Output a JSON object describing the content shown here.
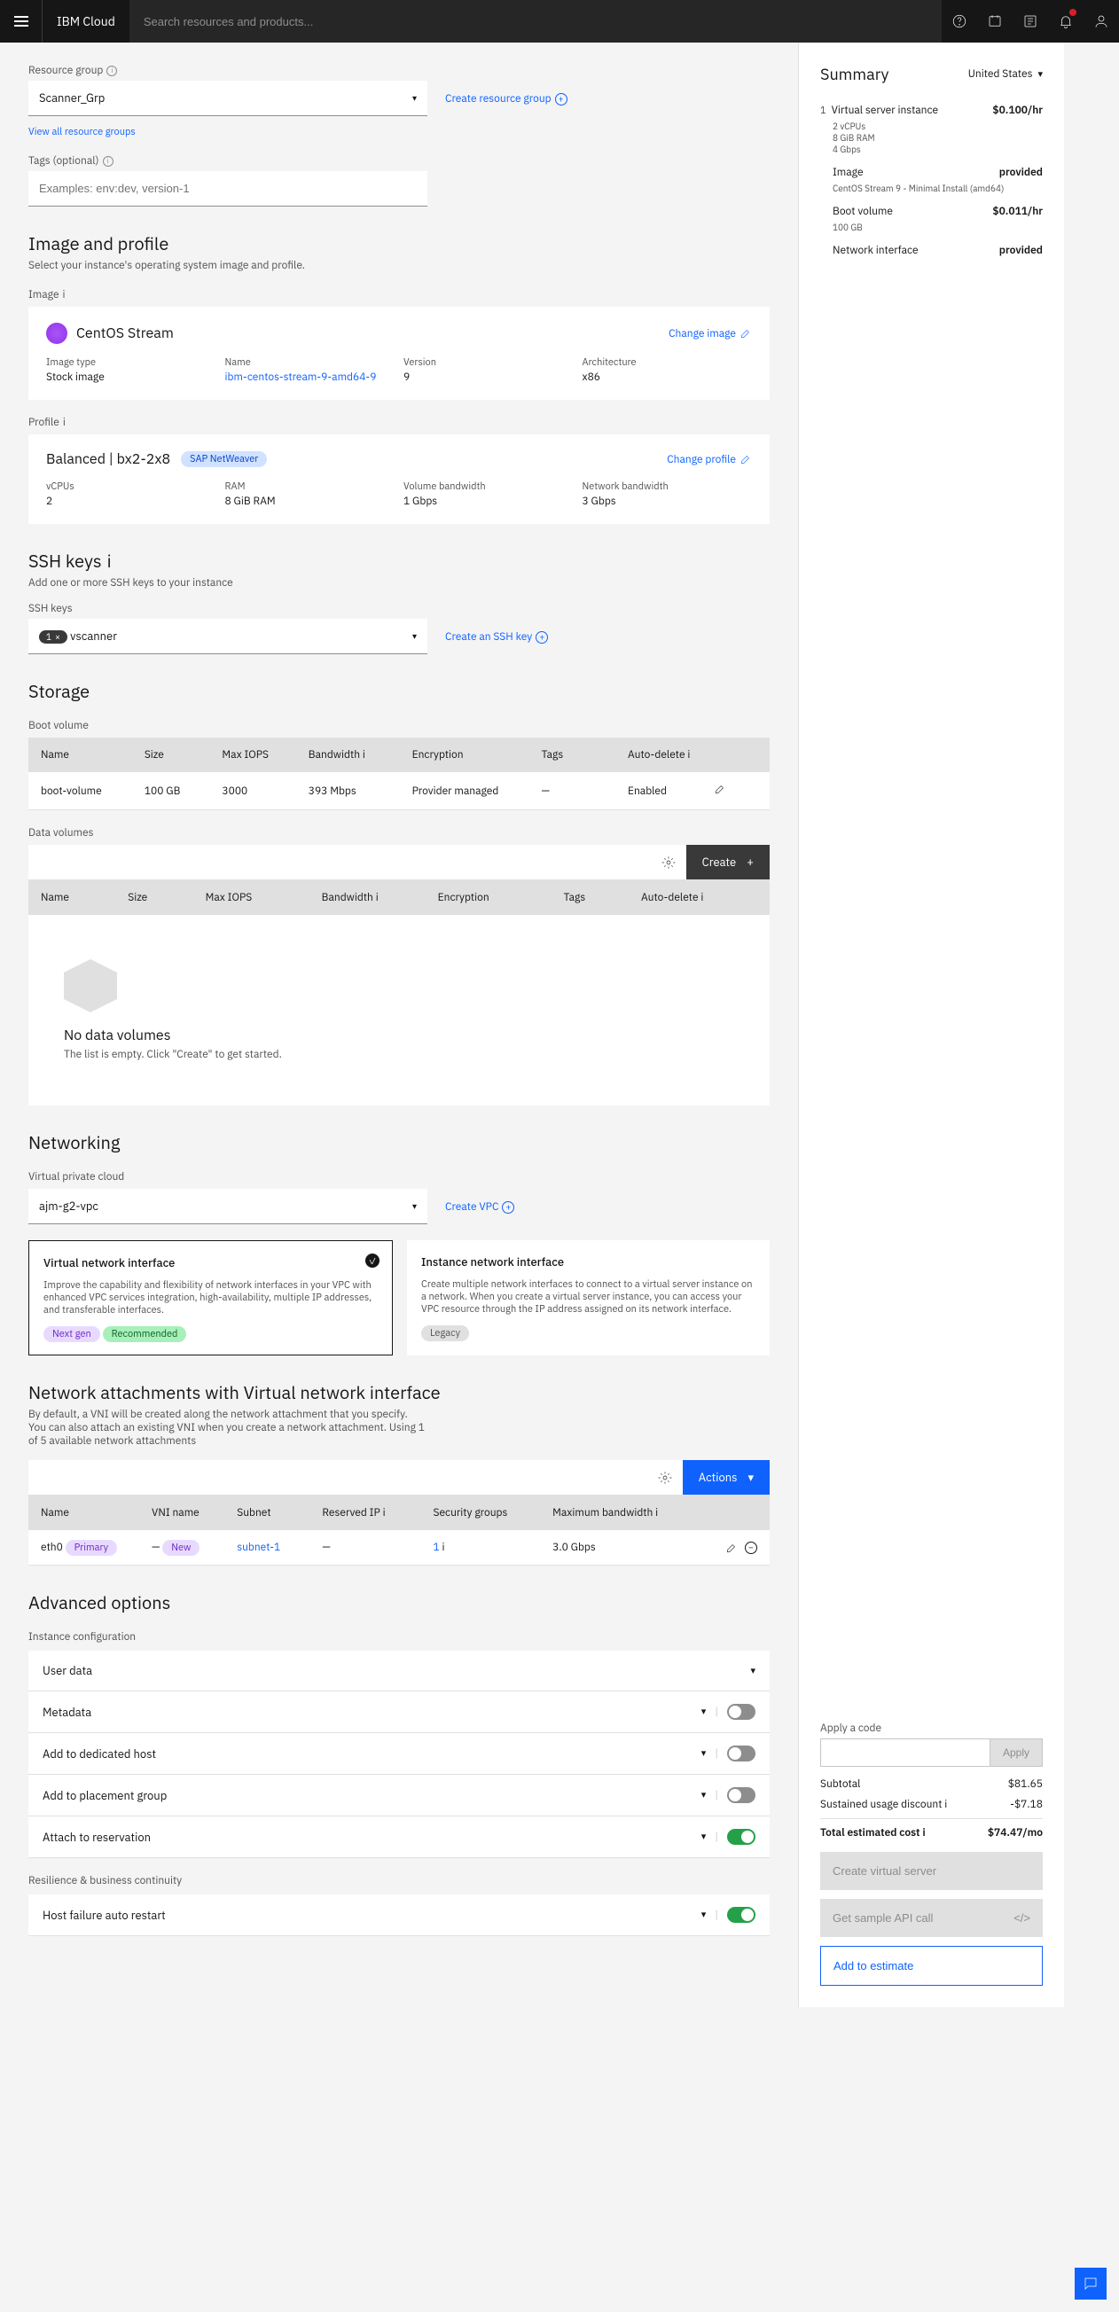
{
  "topbar": {
    "brand": "IBM Cloud",
    "search_placeholder": "Search resources and products..."
  },
  "resource_group": {
    "label": "Resource group",
    "value": "Scanner_Grp",
    "create_label": "Create resource group",
    "view_all": "View all resource groups"
  },
  "tags": {
    "label": "Tags (optional)",
    "placeholder": "Examples: env:dev, version-1"
  },
  "image_profile": {
    "title": "Image and profile",
    "sub": "Select your instance's operating system image and profile.",
    "image_label": "Image",
    "os_name": "CentOS Stream",
    "change_image": "Change image",
    "img_type_k": "Image type",
    "img_type_v": "Stock image",
    "name_k": "Name",
    "name_v": "ibm-centos-stream-9-amd64-9",
    "version_k": "Version",
    "version_v": "9",
    "arch_k": "Architecture",
    "arch_v": "x86",
    "profile_label": "Profile",
    "profile_name": "Balanced | bx2-2x8",
    "profile_badge": "SAP NetWeaver",
    "change_profile": "Change profile",
    "vcpu_k": "vCPUs",
    "vcpu_v": "2",
    "ram_k": "RAM",
    "ram_v": "8 GiB RAM",
    "volbw_k": "Volume bandwidth",
    "volbw_v": "1 Gbps",
    "netbw_k": "Network bandwidth",
    "netbw_v": "3 Gbps"
  },
  "ssh": {
    "title": "SSH keys",
    "sub": "Add one or more SSH keys to your instance",
    "label": "SSH keys",
    "chip_count": "1",
    "chip_name": "vscanner",
    "create": "Create an SSH key"
  },
  "storage": {
    "title": "Storage",
    "boot_label": "Boot volume",
    "th": {
      "name": "Name",
      "size": "Size",
      "iops": "Max IOPS",
      "bw": "Bandwidth",
      "enc": "Encryption",
      "tags": "Tags",
      "auto": "Auto-delete"
    },
    "boot_row": {
      "name": "boot-volume",
      "size": "100 GB",
      "iops": "3000",
      "bw": "393 Mbps",
      "enc": "Provider managed",
      "tags": "—",
      "auto": "Enabled"
    },
    "data_label": "Data volumes",
    "create_btn": "Create",
    "empty_title": "No data volumes",
    "empty_sub": "The list is empty. Click \"Create\" to get started."
  },
  "networking": {
    "title": "Networking",
    "vpc_label": "Virtual private cloud",
    "vpc_value": "ajm-g2-vpc",
    "create_vpc": "Create VPC",
    "card1": {
      "title": "Virtual network interface",
      "desc": "Improve the capability and flexibility of network interfaces in your VPC with enhanced VPC services integration, high-availability, multiple IP addresses, and transferable interfaces.",
      "badge1": "Next gen",
      "badge2": "Recommended"
    },
    "card2": {
      "title": "Instance network interface",
      "desc": "Create multiple network interfaces to connect to a virtual server instance on a network. When you create a virtual server instance, you can access your VPC resource through the IP address assigned on its network interface.",
      "badge": "Legacy"
    }
  },
  "nat": {
    "title": "Network attachments with Virtual network interface",
    "sub": "By default, a VNI will be created along the network attachment that you specify. You can also attach an existing VNI when you create a network attachment. Using 1 of 5 available network attachments",
    "actions": "Actions",
    "th": {
      "name": "Name",
      "vni": "VNI name",
      "subnet": "Subnet",
      "ip": "Reserved IP",
      "sg": "Security groups",
      "bw": "Maximum bandwidth"
    },
    "row": {
      "name": "eth0",
      "badge": "Primary",
      "vni": "—",
      "vni_badge": "New",
      "subnet": "subnet-1",
      "ip": "—",
      "sg": "1",
      "bw": "3.0 Gbps"
    }
  },
  "advanced": {
    "title": "Advanced options",
    "section1": "Instance configuration",
    "items1": [
      "User data",
      "Metadata",
      "Add to dedicated host",
      "Add to placement group",
      "Attach to reservation"
    ],
    "section2": "Resilience & business continuity",
    "items2": [
      "Host failure auto restart"
    ]
  },
  "summary": {
    "title": "Summary",
    "region": "United States",
    "vsi_num": "1",
    "vsi": {
      "n": "Virtual server instance",
      "p": "$0.100/hr",
      "s1": "2 vCPUs",
      "s2": "8 GiB RAM",
      "s3": "4 Gbps"
    },
    "img": {
      "n": "Image",
      "p": "provided",
      "s": "CentOS Stream 9 - Minimal Install (amd64)"
    },
    "boot": {
      "n": "Boot volume",
      "p": "$0.011/hr",
      "s": "100 GB"
    },
    "net": {
      "n": "Network interface",
      "p": "provided"
    },
    "code_label": "Apply a code",
    "apply": "Apply",
    "subtotal_k": "Subtotal",
    "subtotal_v": "$81.65",
    "discount_k": "Sustained usage discount",
    "discount_v": "-$7.18",
    "total_k": "Total estimated cost",
    "total_v": "$74.47/mo",
    "btn1": "Create virtual server",
    "btn2": "Get sample API call",
    "btn3": "Add to estimate"
  }
}
